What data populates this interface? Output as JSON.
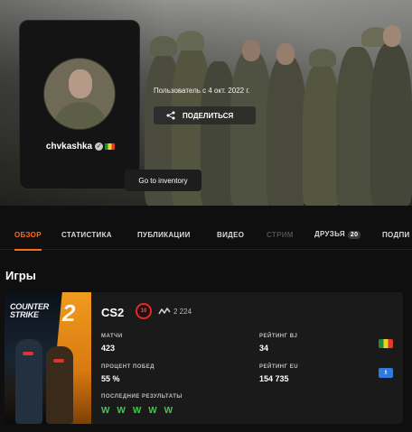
{
  "profile": {
    "username": "chvkashka",
    "member_since": "Пользователь с 4 окт. 2022 г.",
    "share_label": "ПОДЕЛИТЬСЯ",
    "inventory_label": "Go to inventory",
    "verified_icon": "check-icon",
    "flag_colors": [
      "#1e8a3a",
      "#f0d020",
      "#e13a2a"
    ]
  },
  "tabs": [
    {
      "label": "ОБЗОР",
      "state": "active"
    },
    {
      "label": "СТАТИСТИКА",
      "state": "normal"
    },
    {
      "label": "ПУБЛИКАЦИИ",
      "state": "normal"
    },
    {
      "label": "ВИДЕО",
      "state": "normal"
    },
    {
      "label": "СТРИМ",
      "state": "disabled"
    },
    {
      "label": "ДРУЗЬЯ",
      "count": "20",
      "state": "normal"
    },
    {
      "label": "ПОДПИ",
      "state": "normal"
    }
  ],
  "games_section": {
    "title": "Игры",
    "game": {
      "name": "CS2",
      "cover_logo_line1": "COUNTER",
      "cover_logo_line2": "STRIKE",
      "cover_logo_num": "2",
      "level": "10",
      "elo": "2 224",
      "stats": {
        "matches_label": "МАТЧИ",
        "matches_value": "423",
        "rating_bj_label": "РЕЙТИНГ BJ",
        "rating_bj_value": "34",
        "win_rate_label": "ПРОЦЕНТ ПОБЕД",
        "win_rate_value": "55 %",
        "rating_eu_label": "РЕЙТИНГ EU",
        "rating_eu_value": "154 735",
        "recent_label": "ПОСЛЕДНИЕ РЕЗУЛЬТАТЫ",
        "recent_results": "W W W W W"
      },
      "eu_icon": "♗",
      "accent_color": "#ff6a1a",
      "win_color": "#3ecb4a",
      "level_color": "#e02a2a"
    }
  }
}
